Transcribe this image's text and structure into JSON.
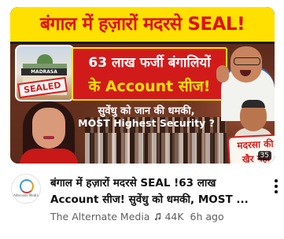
{
  "video": {
    "thumbnail": {
      "headline": "बंगाल में हज़ारों मदरसे SEAL!",
      "panel_line1": "63 लाख फर्जी बंगालियों",
      "panel_line2": "के Account सीज!",
      "quote_line1": "सुवेंधु को जान की धमकी,",
      "quote_line2": "MOST Highest Security ?",
      "madrasa_sign": "MADRASA",
      "sealed_stamp": "SEALED",
      "tag_line1": "मदरसा की",
      "tag_line2": "खैर नहीं",
      "duration": "35"
    },
    "title_line1": "बंगाल में हज़ारों मदरसे SEAL !63 लाख",
    "title_line2": "Account सीज! सुवेंधु को धमकी, MOST ...",
    "channel": "The Alternate Media",
    "views": "44K",
    "age": "6h ago",
    "avatar_text": "Alternate Media",
    "colors": {
      "banner_bg": "#ffe000",
      "headline_red": "#e01010",
      "panel_red": "#d11b1b",
      "meta_gray": "#606060"
    },
    "icons": {
      "verified": "music-note-icon",
      "menu": "more-vert-icon"
    }
  }
}
